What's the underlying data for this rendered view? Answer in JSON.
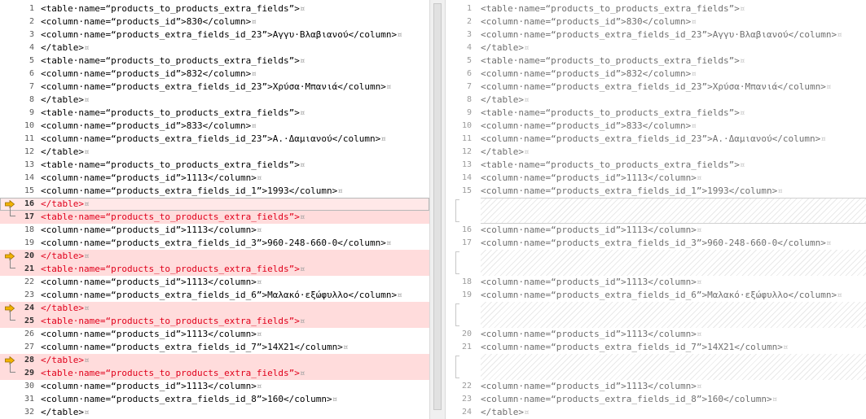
{
  "left": {
    "lines": [
      {
        "n": "1",
        "t": "<table·name=“products_to_products_extra_fields”>",
        "m": "¤"
      },
      {
        "n": "2",
        "t": "<column·name=“products_id”>830</column>",
        "m": "¤"
      },
      {
        "n": "3",
        "t": "<column·name=“products_extra_fields_id_23”>Αγγυ·Βλαβιανού</column>",
        "m": "¤"
      },
      {
        "n": "4",
        "t": "</table>",
        "m": "¤"
      },
      {
        "n": "5",
        "t": "<table·name=“products_to_products_extra_fields”>",
        "m": "¤"
      },
      {
        "n": "6",
        "t": "<column·name=“products_id”>832</column>",
        "m": "¤"
      },
      {
        "n": "7",
        "t": "<column·name=“products_extra_fields_id_23”>Χρύσα·Μπανιά</column>",
        "m": "¤"
      },
      {
        "n": "8",
        "t": "</table>",
        "m": "¤"
      },
      {
        "n": "9",
        "t": "<table·name=“products_to_products_extra_fields”>",
        "m": "¤"
      },
      {
        "n": "10",
        "t": "<column·name=“products_id”>833</column>",
        "m": "¤"
      },
      {
        "n": "11",
        "t": "<column·name=“products_extra_fields_id_23”>Α.·Δαμιανού</column>",
        "m": "¤"
      },
      {
        "n": "12",
        "t": "</table>",
        "m": "¤"
      },
      {
        "n": "13",
        "t": "<table·name=“products_to_products_extra_fields”>",
        "m": "¤"
      },
      {
        "n": "14",
        "t": "<column·name=“products_id”>1113</column>",
        "m": "¤"
      },
      {
        "n": "15",
        "t": "<column·name=“products_extra_fields_id_1”>1993</column>",
        "m": "¤"
      },
      {
        "n": "16",
        "t": "</table>",
        "m": "¤",
        "changed": true,
        "arrow": true,
        "cursor": true
      },
      {
        "n": "17",
        "t": "<table·name=“products_to_products_extra_fields”>",
        "m": "¤",
        "changed": true,
        "brace": true
      },
      {
        "n": "18",
        "t": "<column·name=“products_id”>1113</column>",
        "m": "¤"
      },
      {
        "n": "19",
        "t": "<column·name=“products_extra_fields_id_3”>960-248-660-0</column>",
        "m": "¤"
      },
      {
        "n": "20",
        "t": "</table>",
        "m": "¤",
        "changed": true,
        "arrow": true
      },
      {
        "n": "21",
        "t": "<table·name=“products_to_products_extra_fields”>",
        "m": "¤",
        "changed": true,
        "brace": true
      },
      {
        "n": "22",
        "t": "<column·name=“products_id”>1113</column>",
        "m": "¤"
      },
      {
        "n": "23",
        "t": "<column·name=“products_extra_fields_id_6”>Μαλακό·εξώφυλλο</column>",
        "m": "¤"
      },
      {
        "n": "24",
        "t": "</table>",
        "m": "¤",
        "changed": true,
        "arrow": true
      },
      {
        "n": "25",
        "t": "<table·name=“products_to_products_extra_fields”>",
        "m": "¤",
        "changed": true,
        "brace": true
      },
      {
        "n": "26",
        "t": "<column·name=“products_id”>1113</column>",
        "m": "¤"
      },
      {
        "n": "27",
        "t": "<column·name=“products_extra_fields_id_7”>14X21</column>",
        "m": "¤"
      },
      {
        "n": "28",
        "t": "</table>",
        "m": "¤",
        "changed": true,
        "arrow": true
      },
      {
        "n": "29",
        "t": "<table·name=“products_to_products_extra_fields”>",
        "m": "¤",
        "changed": true,
        "brace": true
      },
      {
        "n": "30",
        "t": "<column·name=“products_id”>1113</column>",
        "m": "¤"
      },
      {
        "n": "31",
        "t": "<column·name=“products_extra_fields_id_8”>160</column>",
        "m": "¤"
      },
      {
        "n": "32",
        "t": "</table>",
        "m": "¤"
      }
    ]
  },
  "right": {
    "lines": [
      {
        "n": "1",
        "t": "<table·name=“products_to_products_extra_fields”>",
        "m": "¤"
      },
      {
        "n": "2",
        "t": "<column·name=“products_id”>830</column>",
        "m": "¤"
      },
      {
        "n": "3",
        "t": "<column·name=“products_extra_fields_id_23”>Αγγυ·Βλαβιανού</column>",
        "m": "¤"
      },
      {
        "n": "4",
        "t": "</table>",
        "m": "¤"
      },
      {
        "n": "5",
        "t": "<table·name=“products_to_products_extra_fields”>",
        "m": "¤"
      },
      {
        "n": "6",
        "t": "<column·name=“products_id”>832</column>",
        "m": "¤"
      },
      {
        "n": "7",
        "t": "<column·name=“products_extra_fields_id_23”>Χρύσα·Μπανιά</column>",
        "m": "¤"
      },
      {
        "n": "8",
        "t": "</table>",
        "m": "¤"
      },
      {
        "n": "9",
        "t": "<table·name=“products_to_products_extra_fields”>",
        "m": "¤"
      },
      {
        "n": "10",
        "t": "<column·name=“products_id”>833</column>",
        "m": "¤"
      },
      {
        "n": "11",
        "t": "<column·name=“products_extra_fields_id_23”>Α.·Δαμιανού</column>",
        "m": "¤"
      },
      {
        "n": "12",
        "t": "</table>",
        "m": "¤"
      },
      {
        "n": "13",
        "t": "<table·name=“products_to_products_extra_fields”>",
        "m": "¤"
      },
      {
        "n": "14",
        "t": "<column·name=“products_id”>1113</column>",
        "m": "¤"
      },
      {
        "n": "15",
        "t": "<column·name=“products_extra_fields_id_1”>1993</column>",
        "m": "¤"
      },
      {
        "gap": true,
        "first": true
      },
      {
        "n": "16",
        "t": "<column·name=“products_id”>1113</column>",
        "m": "¤"
      },
      {
        "n": "17",
        "t": "<column·name=“products_extra_fields_id_3”>960-248-660-0</column>",
        "m": "¤"
      },
      {
        "gap": true
      },
      {
        "n": "18",
        "t": "<column·name=“products_id”>1113</column>",
        "m": "¤"
      },
      {
        "n": "19",
        "t": "<column·name=“products_extra_fields_id_6”>Μαλακό·εξώφυλλο</column>",
        "m": "¤"
      },
      {
        "gap": true
      },
      {
        "n": "20",
        "t": "<column·name=“products_id”>1113</column>",
        "m": "¤"
      },
      {
        "n": "21",
        "t": "<column·name=“products_extra_fields_id_7”>14X21</column>",
        "m": "¤"
      },
      {
        "gap": true
      },
      {
        "n": "22",
        "t": "<column·name=“products_id”>1113</column>",
        "m": "¤"
      },
      {
        "n": "23",
        "t": "<column·name=“products_extra_fields_id_8”>160</column>",
        "m": "¤"
      },
      {
        "n": "24",
        "t": "</table>",
        "m": "¤"
      }
    ]
  },
  "icons": {
    "arrow": "current-diff-arrow-icon",
    "brace": "diff-block-brace-icon"
  },
  "colors": {
    "changed_bg": "#ffdcdc",
    "changed_text": "#e0001b",
    "arrow": "#f2b300"
  }
}
